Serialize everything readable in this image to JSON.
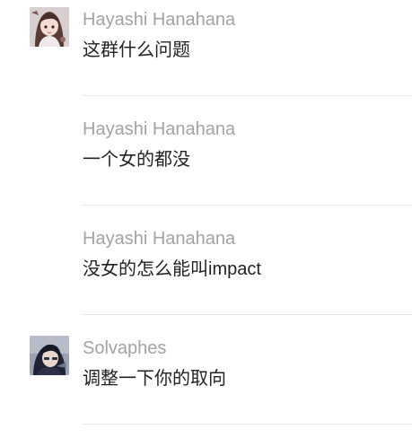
{
  "messages": [
    {
      "author": "Hayashi Hanahana",
      "text": "这群什么问题",
      "avatar": "anime-girl-avatar"
    },
    {
      "author": "Hayashi Hanahana",
      "text": "一个女的都没",
      "avatar": ""
    },
    {
      "author": "Hayashi Hanahana",
      "text": "没女的怎么能叫impact",
      "avatar": ""
    },
    {
      "author": "Solvaphes",
      "text": "调整一下你的取向",
      "avatar": "dark-haired-character-avatar"
    }
  ],
  "colors": {
    "author": "#a3a3a3",
    "text": "#222222",
    "divider": "#e6e6e6"
  }
}
